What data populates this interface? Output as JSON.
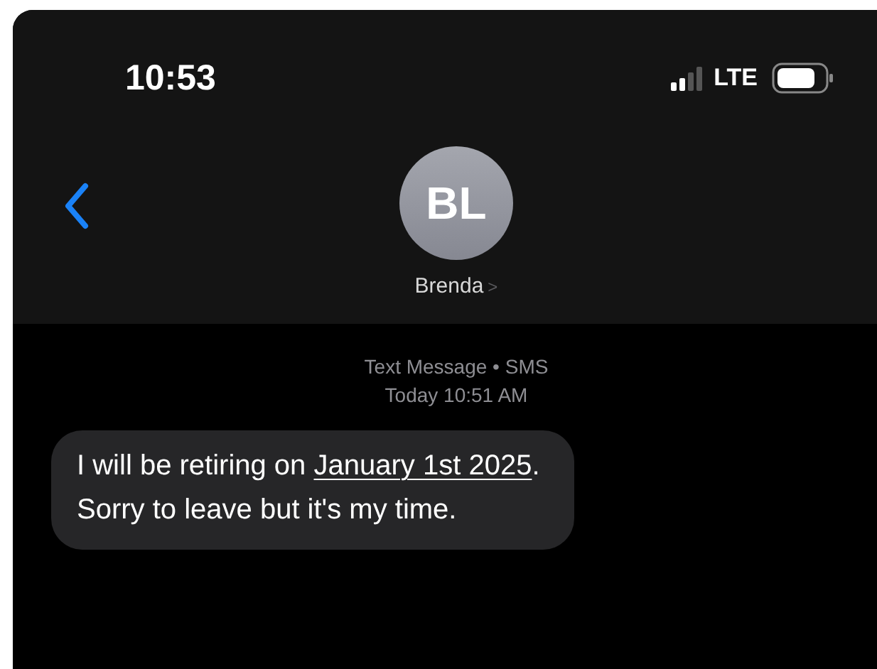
{
  "status_bar": {
    "time": "10:53",
    "network": "LTE"
  },
  "header": {
    "avatar_initials": "BL",
    "contact_name": "Brenda",
    "chevron": ">"
  },
  "thread": {
    "service": "Text Message • SMS",
    "timestamp": "Today 10:51 AM",
    "messages": [
      {
        "parts": [
          {
            "kind": "text",
            "text": "I will be retiring on "
          },
          {
            "kind": "link",
            "text": "January 1st 2025"
          },
          {
            "kind": "text",
            "text": ".\nSorry to leave but it's my time."
          }
        ]
      }
    ]
  }
}
